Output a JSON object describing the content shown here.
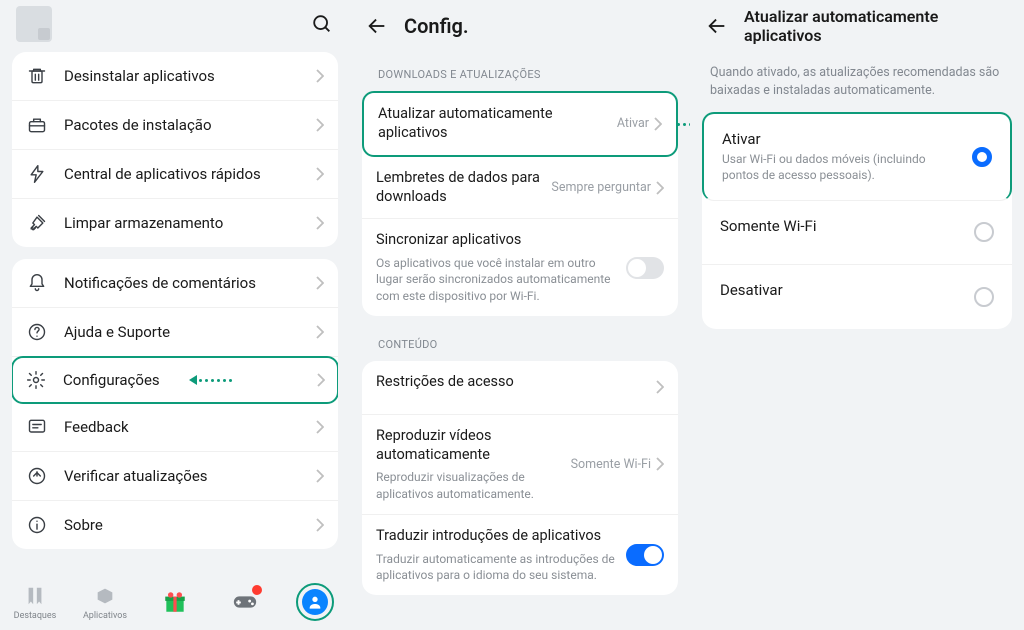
{
  "panel1": {
    "menu1": [
      {
        "icon": "trash",
        "label": "Desinstalar aplicativos"
      },
      {
        "icon": "briefcase",
        "label": "Pacotes de instalação"
      },
      {
        "icon": "bolt",
        "label": "Central de aplicativos rápidos"
      },
      {
        "icon": "broom",
        "label": "Limpar armazenamento"
      }
    ],
    "menu2": [
      {
        "icon": "bell",
        "label": "Notificações de comentários"
      },
      {
        "icon": "help",
        "label": "Ajuda e Suporte"
      },
      {
        "icon": "gear",
        "label": "Configurações",
        "highlight": true,
        "has_annot_arrow": true
      },
      {
        "icon": "feedback",
        "label": "Feedback"
      },
      {
        "icon": "update",
        "label": "Verificar atualizações"
      },
      {
        "icon": "info",
        "label": "Sobre"
      }
    ],
    "nav": {
      "tab1": "Destaques",
      "tab2": "Aplicativos"
    }
  },
  "panel2": {
    "title": "Config.",
    "section1": "DOWNLOADS E ATUALIZAÇÕES",
    "rows1": [
      {
        "title": "Atualizar automaticamente aplicativos",
        "value": "Ativar",
        "highlight": true
      },
      {
        "title": "Lembretes de dados para downloads",
        "value": "Sempre perguntar"
      },
      {
        "title": "Sincronizar aplicativos",
        "sub": "Os aplicativos que você instalar em outro lugar serão sincronizados automaticamente com este dispositivo por Wi-Fi.",
        "toggle": "off"
      }
    ],
    "section2": "CONTEÚDO",
    "rows2": [
      {
        "title": "Restrições de acesso"
      },
      {
        "title": "Reproduzir vídeos automaticamente",
        "sub": "Reproduzir visualizações de aplicativos automaticamente.",
        "value": "Somente Wi-Fi"
      },
      {
        "title": "Traduzir introduções de aplicativos",
        "sub": "Traduzir automaticamente as introduções de aplicativos para o idioma do seu sistema.",
        "toggle": "on"
      }
    ]
  },
  "panel3": {
    "title": "Atualizar automaticamente aplicativos",
    "desc": "Quando ativado, as atualizações recomendadas são baixadas e instaladas automaticamente.",
    "options": [
      {
        "title": "Ativar",
        "sub": "Usar Wi-Fi ou dados móveis (incluindo pontos de acesso pessoais).",
        "selected": true,
        "highlight": true
      },
      {
        "title": "Somente Wi-Fi",
        "selected": false
      },
      {
        "title": "Desativar",
        "selected": false
      }
    ]
  }
}
